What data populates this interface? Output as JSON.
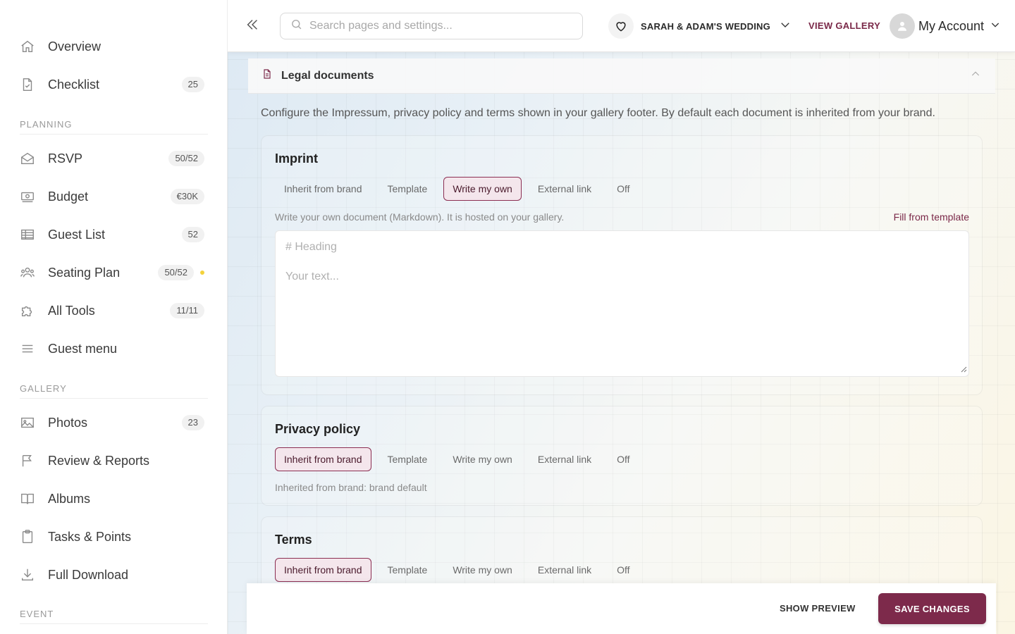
{
  "sidebar": {
    "items_top": [
      {
        "label": "Overview",
        "icon": "home-icon",
        "badge": null
      },
      {
        "label": "Checklist",
        "icon": "checklist-icon",
        "badge": "25"
      }
    ],
    "planning_label": "PLANNING",
    "planning": [
      {
        "label": "RSVP",
        "icon": "envelope-icon",
        "badge": "50/52"
      },
      {
        "label": "Budget",
        "icon": "money-icon",
        "badge": "€30K"
      },
      {
        "label": "Guest List",
        "icon": "table-icon",
        "badge": "52"
      },
      {
        "label": "Seating Plan",
        "icon": "people-icon",
        "badge": "50/52"
      },
      {
        "label": "All Tools",
        "icon": "puzzle-icon",
        "badge": "11/11"
      },
      {
        "label": "Guest menu",
        "icon": "menu-icon",
        "badge": null
      }
    ],
    "gallery_label": "GALLERY",
    "gallery": [
      {
        "label": "Photos",
        "icon": "image-icon",
        "badge": "23"
      },
      {
        "label": "Review & Reports",
        "icon": "flag-icon",
        "badge": null
      },
      {
        "label": "Albums",
        "icon": "book-icon",
        "badge": null
      },
      {
        "label": "Tasks & Points",
        "icon": "clipboard-icon",
        "badge": null
      },
      {
        "label": "Full Download",
        "icon": "download-icon",
        "badge": null
      }
    ],
    "event_label": "EVENT",
    "status_dot_color": "#f3d23c"
  },
  "header": {
    "search_placeholder": "Search pages and settings...",
    "wedding_name": "SARAH & ADAM'S WEDDING",
    "view_gallery": "VIEW GALLERY",
    "account": "My Account"
  },
  "panel": {
    "title": "Legal documents",
    "intro": "Configure the Impressum, privacy policy and terms shown in your gallery footer. By default each document is inherited from your brand."
  },
  "options": [
    "Inherit from brand",
    "Template",
    "Write my own",
    "External link",
    "Off"
  ],
  "imprint": {
    "title": "Imprint",
    "selected": "Write my own",
    "hint": "Write your own document (Markdown). It is hosted on your gallery.",
    "fill_link": "Fill from template",
    "placeholder_heading": "# Heading",
    "placeholder_text": "Your text..."
  },
  "privacy": {
    "title": "Privacy policy",
    "selected": "Inherit from brand",
    "hint": "Inherited from brand: brand default"
  },
  "terms": {
    "title": "Terms",
    "selected": "Inherit from brand"
  },
  "footer": {
    "show_preview": "SHOW PREVIEW",
    "save": "SAVE CHANGES"
  },
  "colors": {
    "accent": "#7d2a4b",
    "accent_light": "#f4e6ec"
  }
}
